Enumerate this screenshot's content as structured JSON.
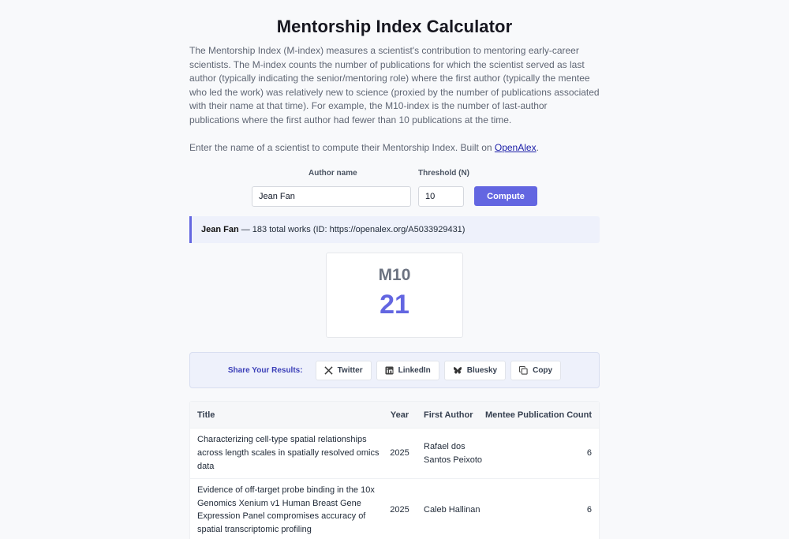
{
  "page": {
    "title": "Mentorship Index Calculator",
    "description": "The Mentorship Index (M-index) measures a scientist's contribution to mentoring early-career scientists. The M-index counts the number of publications for which the scientist served as last author (typically indicating the senior/mentoring role) where the first author (typically the mentee who led the work) was relatively new to science (proxied by the number of publications associated with their name at that time). For example, the M10-index is the number of last-author publications where the first author had fewer than 10 publications at the time.",
    "instruction_prefix": "Enter the name of a scientist to compute their Mentorship Index. Built on ",
    "instruction_link": "OpenAlex",
    "instruction_suffix": "."
  },
  "form": {
    "author_label": "Author name",
    "author_value": "Jean Fan",
    "threshold_label": "Threshold (N)",
    "threshold_value": "10",
    "compute_label": "Compute"
  },
  "result": {
    "author_name": "Jean Fan",
    "author_details": " — 183 total works (ID: https://openalex.org/A5033929431)",
    "metric_label": "M10",
    "metric_value": "21"
  },
  "share": {
    "label": "Share Your Results:",
    "buttons": [
      {
        "label": "Twitter",
        "icon": "x-icon"
      },
      {
        "label": "LinkedIn",
        "icon": "linkedin-icon"
      },
      {
        "label": "Bluesky",
        "icon": "bluesky-icon"
      },
      {
        "label": "Copy",
        "icon": "copy-icon"
      }
    ]
  },
  "table": {
    "headers": [
      "Title",
      "Year",
      "First Author",
      "Mentee Publication Count"
    ],
    "rows": [
      {
        "title": "Characterizing cell-type spatial relationships across length scales in spatially resolved omics data",
        "year": "2025",
        "first_author": "Rafael dos Santos Peixoto",
        "count": "6"
      },
      {
        "title": "Evidence of off-target probe binding in the 10x Genomics Xenium v1 Human Breast Gene Expression Panel compromises accuracy of spatial transcriptomic profiling",
        "year": "2025",
        "first_author": "Caleb Hallinan",
        "count": "6"
      }
    ]
  },
  "colors": {
    "accent": "#6366e1",
    "panel": "#eef1fb",
    "link": "#1d20a8"
  }
}
